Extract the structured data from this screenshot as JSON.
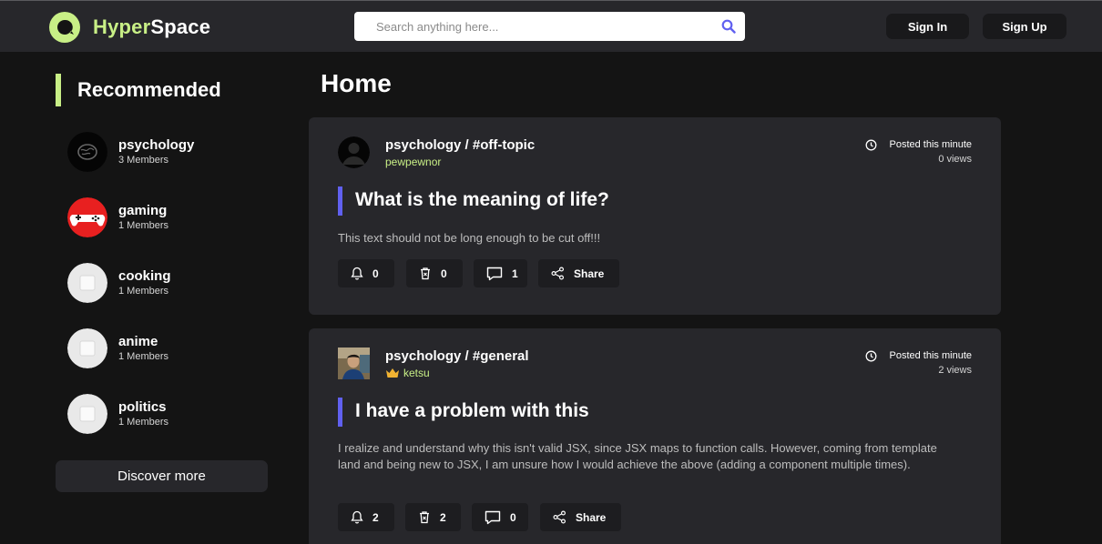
{
  "header": {
    "logo_part1": "Hyper",
    "logo_part2": "Space",
    "search_placeholder": "Search anything here...",
    "sign_in_label": "Sign In",
    "sign_up_label": "Sign Up"
  },
  "sidebar": {
    "title": "Recommended",
    "communities": [
      {
        "name": "psychology",
        "members": "3 Members"
      },
      {
        "name": "gaming",
        "members": "1 Members"
      },
      {
        "name": "cooking",
        "members": "1 Members"
      },
      {
        "name": "anime",
        "members": "1 Members"
      },
      {
        "name": "politics",
        "members": "1 Members"
      }
    ],
    "discover_label": "Discover more"
  },
  "main": {
    "title": "Home",
    "posts": [
      {
        "channel": "psychology / #off-topic",
        "author": "pewpewnor",
        "posted": "Posted this minute",
        "views": "0 views",
        "title": "What is the meaning of life?",
        "body": "This text should not be long enough to be cut off!!!",
        "likes": "0",
        "dislikes": "0",
        "comments": "1",
        "share_label": "Share"
      },
      {
        "channel": "psychology / #general",
        "author": "ketsu",
        "posted": "Posted this minute",
        "views": "2 views",
        "title": "I have a problem with this",
        "body": "I realize and understand why this isn't valid JSX, since JSX maps to function calls. However, coming from template land and being new to JSX, I am unsure how I would achieve the above (adding a component multiple times).",
        "likes": "2",
        "dislikes": "2",
        "comments": "0",
        "share_label": "Share"
      }
    ]
  },
  "colors": {
    "accent": "#c8ef86",
    "title_bar": "#6060f0",
    "search_icon": "#6060f0",
    "panel": "#27272b",
    "background": "#141414"
  },
  "icons": [
    "hyperspace-logo-icon",
    "search-icon",
    "clock-icon",
    "bell-icon",
    "trash-icon",
    "comment-icon",
    "share-icon",
    "crown-icon"
  ]
}
